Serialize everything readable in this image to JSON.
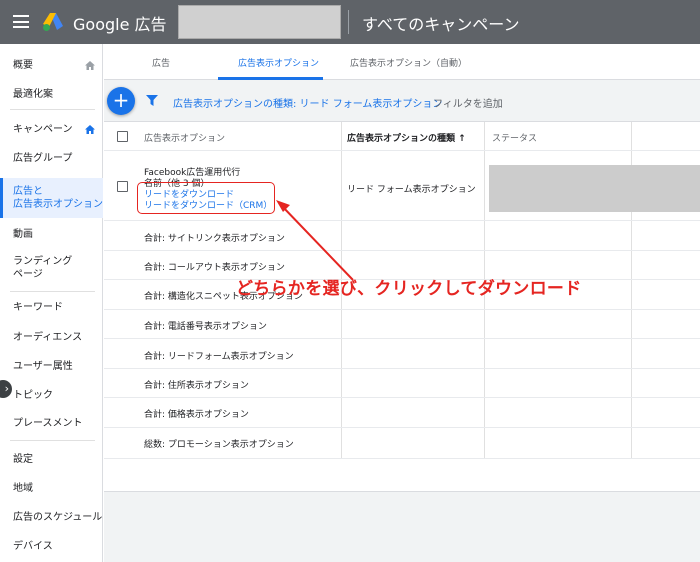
{
  "header": {
    "app_title": "Google 広告",
    "campaign_title": "すべてのキャンペーン"
  },
  "sidebar": {
    "items": [
      {
        "label": "概要"
      },
      {
        "label": "最適化案"
      },
      {
        "label": "キャンペーン"
      },
      {
        "label": "広告グループ"
      },
      {
        "label": "広告と\n広告表示オプション"
      },
      {
        "label": "動画"
      },
      {
        "label": "ランディング\nページ"
      },
      {
        "label": "キーワード"
      },
      {
        "label": "オーディエンス"
      },
      {
        "label": "ユーザー属性"
      },
      {
        "label": "トピック"
      },
      {
        "label": "プレースメント"
      },
      {
        "label": "設定"
      },
      {
        "label": "地域"
      },
      {
        "label": "広告のスケジュール"
      },
      {
        "label": "デバイス"
      }
    ]
  },
  "tabs": [
    {
      "label": "広告"
    },
    {
      "label": "広告表示オプション"
    },
    {
      "label": "広告表示オプション（自動）"
    }
  ],
  "toolbar": {
    "add_symbol": "+",
    "filter_text": "広告表示オプションの種類: リード フォーム表示オプション",
    "filter_add": "フィルタを追加"
  },
  "table": {
    "columns": [
      "広告表示オプション",
      "広告表示オプションの種類",
      "ステータス"
    ],
    "sort_indicator": "↑",
    "row": {
      "name": "Facebook広告運用代行",
      "sub": "名前（他 3 個）",
      "link1": "リードをダウンロード",
      "link2": "リードをダウンロード（CRM）",
      "type": "リード フォーム表示オプション"
    },
    "totals": [
      "合計: サイトリンク表示オプション",
      "合計: コールアウト表示オプション",
      "合計: 構造化スニペット表示オプション",
      "合計: 電話番号表示オプション",
      "合計: リードフォーム表示オプション",
      "合計: 住所表示オプション",
      "合計: 価格表示オプション",
      "総数: プロモーション表示オプション"
    ]
  },
  "annotation": {
    "text": "どちらかを選び、クリックしてダウンロード",
    "color": "#e52521"
  },
  "colors": {
    "header_bg": "#5f6368",
    "accent": "#1a73e8"
  }
}
